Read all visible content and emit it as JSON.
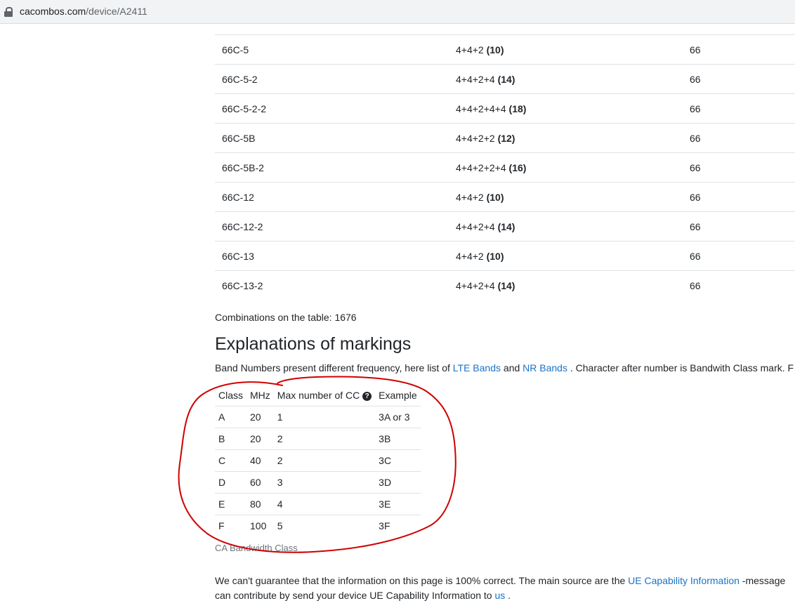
{
  "browser": {
    "url_host": "cacombos.com",
    "url_path": "/device/A2411"
  },
  "combos": [
    {
      "band": "66C-5",
      "bw": "4+4+2",
      "total": "(10)",
      "base": "66"
    },
    {
      "band": "66C-5-2",
      "bw": "4+4+2+4",
      "total": "(14)",
      "base": "66"
    },
    {
      "band": "66C-5-2-2",
      "bw": "4+4+2+4+4",
      "total": "(18)",
      "base": "66"
    },
    {
      "band": "66C-5B",
      "bw": "4+4+2+2",
      "total": "(12)",
      "base": "66"
    },
    {
      "band": "66C-5B-2",
      "bw": "4+4+2+2+4",
      "total": "(16)",
      "base": "66"
    },
    {
      "band": "66C-12",
      "bw": "4+4+2",
      "total": "(10)",
      "base": "66"
    },
    {
      "band": "66C-12-2",
      "bw": "4+4+2+4",
      "total": "(14)",
      "base": "66"
    },
    {
      "band": "66C-13",
      "bw": "4+4+2",
      "total": "(10)",
      "base": "66"
    },
    {
      "band": "66C-13-2",
      "bw": "4+4+2+4",
      "total": "(14)",
      "base": "66"
    }
  ],
  "count_label": "Combinations on the table: 1676",
  "explanations": {
    "heading": "Explanations of markings",
    "text_before": "Band Numbers present different frequency, here list of ",
    "lte_link": "LTE Bands",
    "and": " and ",
    "nr_link": "NR Bands",
    "text_after": " . Character after number is Bandwith Class mark. F"
  },
  "class_table": {
    "headers": [
      "Class",
      "MHz",
      "Max number of CC",
      "Example"
    ],
    "help_icon": "?",
    "rows": [
      [
        "A",
        "20",
        "1",
        "3A or 3"
      ],
      [
        "B",
        "20",
        "2",
        "3B"
      ],
      [
        "C",
        "40",
        "2",
        "3C"
      ],
      [
        "D",
        "60",
        "3",
        "3D"
      ],
      [
        "E",
        "80",
        "4",
        "3E"
      ],
      [
        "F",
        "100",
        "5",
        "3F"
      ]
    ],
    "caption": "CA Bandwidth Class"
  },
  "note": {
    "line1_before": "We can't guarantee that the information on this page is 100% correct. The main source are the ",
    "ue_link": "UE Capability Information",
    "line1_after": " -message",
    "line2_before": "can contribute by send your device UE Capability Information to ",
    "us_link": "us",
    "line2_after": " ."
  },
  "colors": {
    "link": "#1a73c8",
    "annotation": "#d00000"
  }
}
